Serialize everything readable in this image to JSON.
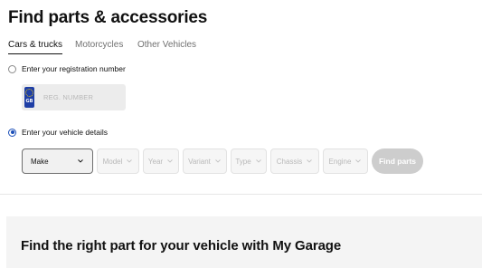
{
  "header": {
    "title": "Find parts & accessories"
  },
  "tabs": [
    {
      "label": "Cars & trucks",
      "active": true
    },
    {
      "label": "Motorcycles",
      "active": false
    },
    {
      "label": "Other Vehicles",
      "active": false
    }
  ],
  "registration": {
    "option_label": "Enter your registration number",
    "selected": false,
    "plate_country_code": "GB",
    "placeholder": "REG. NUMBER",
    "value": ""
  },
  "vehicle_details": {
    "option_label": "Enter your vehicle details",
    "selected": true,
    "selects": [
      {
        "label": "Make",
        "enabled": true
      },
      {
        "label": "Model",
        "enabled": false
      },
      {
        "label": "Year",
        "enabled": false
      },
      {
        "label": "Variant",
        "enabled": false
      },
      {
        "label": "Type",
        "enabled": false
      },
      {
        "label": "Chassis",
        "enabled": false
      },
      {
        "label": "Engine",
        "enabled": false
      }
    ],
    "find_button_label": "Find parts"
  },
  "promo": {
    "title": "Find the right part for your vehicle with My Garage"
  },
  "colors": {
    "accent_radio": "#1b4fb8",
    "plate_band": "#1f3fa6",
    "button_disabled": "#cdcdcd"
  },
  "icons": {
    "select_chevron": "chevron-down-icon",
    "plate_flag": "eu-flag-icon"
  }
}
